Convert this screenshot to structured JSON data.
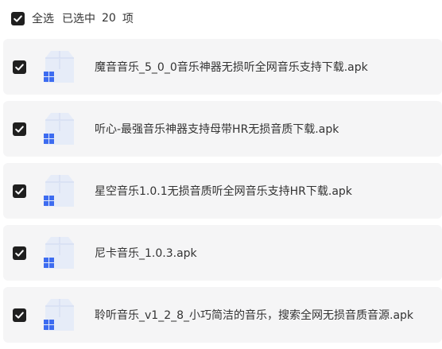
{
  "header": {
    "select_all_label": "全选",
    "selected_prefix": "已选中",
    "selected_count": "20",
    "selected_suffix": "项"
  },
  "files": [
    {
      "name": "魔音音乐_5_0_0音乐神器无损听全网音乐支持下载.apk",
      "checked": true,
      "icon": "apk-file-icon"
    },
    {
      "name": "听心-最强音乐神器支持母带HR无损音质下载.apk",
      "checked": true,
      "icon": "apk-file-icon"
    },
    {
      "name": "星空音乐1.0.1无损音质听全网音乐支持HR下载.apk",
      "checked": true,
      "icon": "apk-file-icon"
    },
    {
      "name": "尼卡音乐_1.0.3.apk",
      "checked": true,
      "icon": "apk-file-icon"
    },
    {
      "name": "聆听音乐_v1_2_8_小巧简洁的音乐，搜索全网无损音质音源.apk",
      "checked": true,
      "icon": "apk-file-icon"
    }
  ],
  "colors": {
    "checkbox": "#1f1f1f",
    "row_background": "#f5f5f6",
    "icon_body": "#e6ecf8",
    "icon_accent": "#3d6cf0"
  }
}
